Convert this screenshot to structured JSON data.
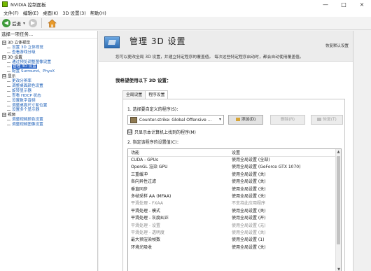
{
  "window": {
    "title": "NVIDIA 控制面板",
    "controls": [
      "—",
      "□",
      "×"
    ]
  },
  "menu": [
    "文件(F)",
    "编辑(E)",
    "桌面(K)",
    "3D 设置(3)",
    "帮助(H)"
  ],
  "toolbar": {
    "back_label": "后退"
  },
  "left_pane": {
    "header": "选择一项任务...",
    "tree": [
      {
        "type": "cat",
        "label": "3D 立体视觉",
        "expander": "⊟"
      },
      {
        "type": "leaf",
        "label": "设置 3D 立体视觉"
      },
      {
        "type": "leaf",
        "label": "查看游戏分级"
      },
      {
        "type": "cat",
        "label": "3D 设置",
        "expander": "⊟"
      },
      {
        "type": "leaf",
        "label": "通过预览调整图像设置"
      },
      {
        "type": "leaf",
        "label": "管理 3D 设置",
        "selected": true
      },
      {
        "type": "leaf",
        "label": "配置 Surround、PhysX"
      },
      {
        "type": "cat",
        "label": "显示",
        "expander": "⊟"
      },
      {
        "type": "leaf",
        "label": "更改分辨率"
      },
      {
        "type": "leaf",
        "label": "调整桌面颜色设置"
      },
      {
        "type": "leaf",
        "label": "旋转显示器"
      },
      {
        "type": "leaf",
        "label": "查看 HDCP 状态"
      },
      {
        "type": "leaf",
        "label": "设置数字音频"
      },
      {
        "type": "leaf",
        "label": "调整桌面尺寸和位置"
      },
      {
        "type": "leaf",
        "label": "设置多个显示器"
      },
      {
        "type": "cat",
        "label": "视频",
        "expander": "⊟"
      },
      {
        "type": "leaf",
        "label": "调整视频颜色设置"
      },
      {
        "type": "leaf",
        "label": "调整视频图像设置"
      }
    ]
  },
  "main": {
    "title": "管理 3D 设置",
    "restore_link": "恢复默认设置",
    "description": "您可以更改全局 3D 设置，并建立特定程序的覆盖值。 每次这些特定程序启动时，都会自动使用覆盖值。",
    "section_heading": "我希望使用以下 3D 设置：",
    "tabs": [
      "全局设置",
      "程序设置"
    ],
    "step1_label": "1. 选择要自定义的程序(S)：",
    "program_selected": "Counter-strike: Global Offensive ...",
    "buttons": {
      "add": "添加(D)",
      "delete": "删除(R)",
      "restore": "恢复(T)"
    },
    "show_found_label": "只显示本计算机上找到的程序(M)",
    "show_found_check": "☑",
    "step2_label": "2. 指定该程序的设置值(C)：",
    "grid_headers": {
      "feature": "功能",
      "setting": "设置"
    },
    "rows": [
      {
        "feature": "CUDA - GPUs",
        "setting": "使用全局设置 (全部)"
      },
      {
        "feature": "OpenGL 渲染 GPU",
        "setting": "使用全局设置 (GeForce GTX 1070)"
      },
      {
        "feature": "三重缓冲",
        "setting": "使用全局设置 (关)"
      },
      {
        "feature": "各向异性过滤",
        "setting": "使用全局设置 (关)"
      },
      {
        "feature": "垂直同步",
        "setting": "使用全局设置 (关)"
      },
      {
        "feature": "多帧采样 AA (MFAA)",
        "setting": "使用全局设置 (关)"
      },
      {
        "feature": "平滑处理 - FXAA",
        "setting": "不支持此应用程序",
        "muted": true
      },
      {
        "feature": "平滑处理 - 模式",
        "setting": "使用全局设置 (关)"
      },
      {
        "feature": "平滑处理 - 灰度纠正",
        "setting": "使用全局设置 (开)"
      },
      {
        "feature": "平滑处理 - 设置",
        "setting": "使用全局设置 (无)",
        "muted": true
      },
      {
        "feature": "平滑处理 - 透明度",
        "setting": "使用全局设置 (关)",
        "muted": true
      },
      {
        "feature": "最大预渲染帧数",
        "setting": "使用全局设置 (1)"
      },
      {
        "feature": "环境光吸收",
        "setting": "使用全局设置 (关)"
      }
    ]
  }
}
